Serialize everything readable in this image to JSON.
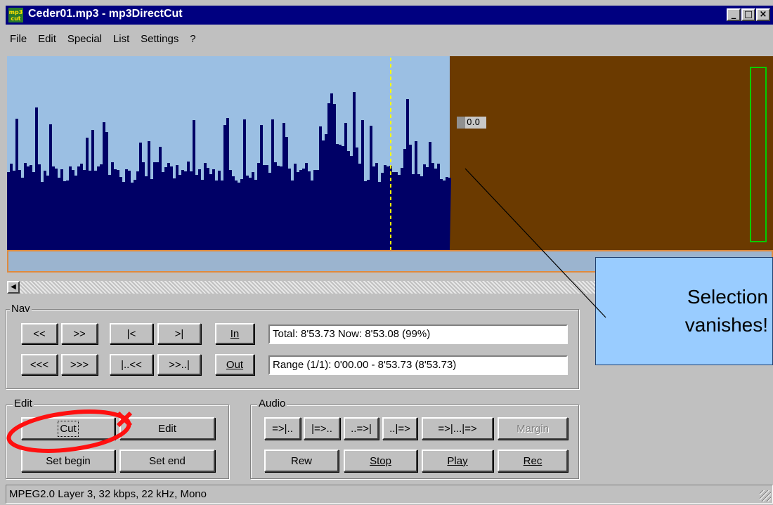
{
  "window": {
    "title": "Ceder01.mp3 - mp3DirectCut",
    "icon_text": "mp3 cut",
    "caption_buttons": [
      "_",
      "□",
      "×"
    ]
  },
  "menu": [
    "File",
    "Edit",
    "Special",
    "List",
    "Settings",
    "?"
  ],
  "waveform": {
    "level_label": "0.0",
    "colors": {
      "selected_bg": "#9bbfe3",
      "wave": "#000066",
      "unselected_bg": "#6b3a00",
      "cursor": "#ffff00",
      "level_meter": "#00cc00"
    }
  },
  "nav": {
    "label": "Nav",
    "buttons_row1": [
      "<<",
      ">>",
      "|<",
      ">|"
    ],
    "buttons_row2": [
      "<<<",
      ">>>",
      "|..<<",
      ">>..|"
    ],
    "in_label": "In",
    "out_label": "Out",
    "total_text": "Total: 8'53.73   Now: 8'53.08   (99%)",
    "range_text": "Range (1/1): 0'00.00 - 8'53.73 (8'53.73)"
  },
  "edit": {
    "label": "Edit",
    "cut_label": "Cut",
    "edit_label": "Edit",
    "set_begin_label": "Set begin",
    "set_end_label": "Set end"
  },
  "audio": {
    "label": "Audio",
    "buttons_row1": [
      "=>|..",
      "|=>..",
      "..=>|",
      "..|=>",
      "=>|...|=>",
      "Margin"
    ],
    "rew_label": "Rew",
    "stop_label": "Stop",
    "play_label": "Play",
    "rec_label": "Rec"
  },
  "annotation": {
    "line1": "Selection",
    "line2": "vanishes!"
  },
  "status": "MPEG2.0 Layer 3, 32 kbps, 22 kHz, Mono"
}
